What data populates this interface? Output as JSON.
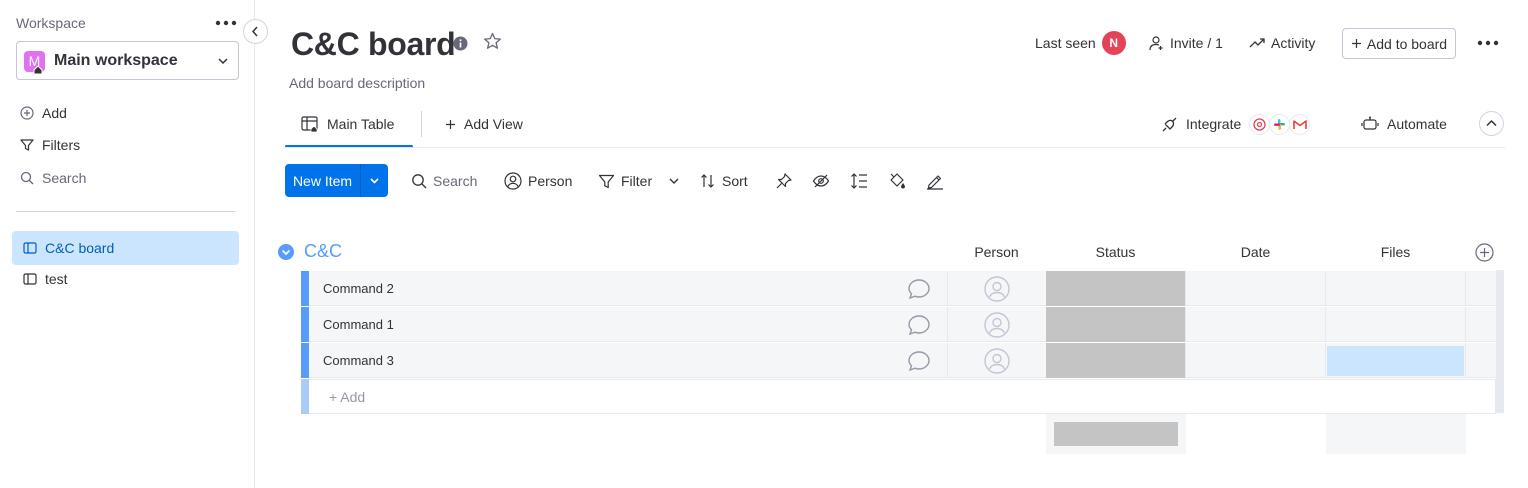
{
  "sidebar": {
    "workspace_label": "Workspace",
    "workspace_avatar": "M",
    "workspace_name": "Main workspace",
    "add_label": "Add",
    "filters_label": "Filters",
    "search_label": "Search",
    "boards": [
      {
        "label": "C&C board",
        "active": true
      },
      {
        "label": "test",
        "active": false
      }
    ]
  },
  "header": {
    "title": "C&C board",
    "description": "Add board description",
    "last_seen_label": "Last seen",
    "last_seen_initial": "N",
    "invite_label": "Invite / 1",
    "activity_label": "Activity",
    "add_to_board_label": "Add to board"
  },
  "tabs": {
    "main_table": "Main Table",
    "add_view": "Add View",
    "integrate": "Integrate",
    "automate": "Automate"
  },
  "toolbar": {
    "new_item": "New Item",
    "search": "Search",
    "person": "Person",
    "filter": "Filter",
    "sort": "Sort"
  },
  "group": {
    "title": "C&C",
    "columns": {
      "person": "Person",
      "status": "Status",
      "date": "Date",
      "files": "Files"
    },
    "rows": [
      {
        "name": "Command 2"
      },
      {
        "name": "Command 1"
      },
      {
        "name": "Command 3"
      }
    ],
    "add_row": "+ Add"
  },
  "colors": {
    "accent": "#0073ea",
    "group": "#579bfc",
    "status_empty": "#c4c4c4",
    "selected": "#cce5ff"
  }
}
